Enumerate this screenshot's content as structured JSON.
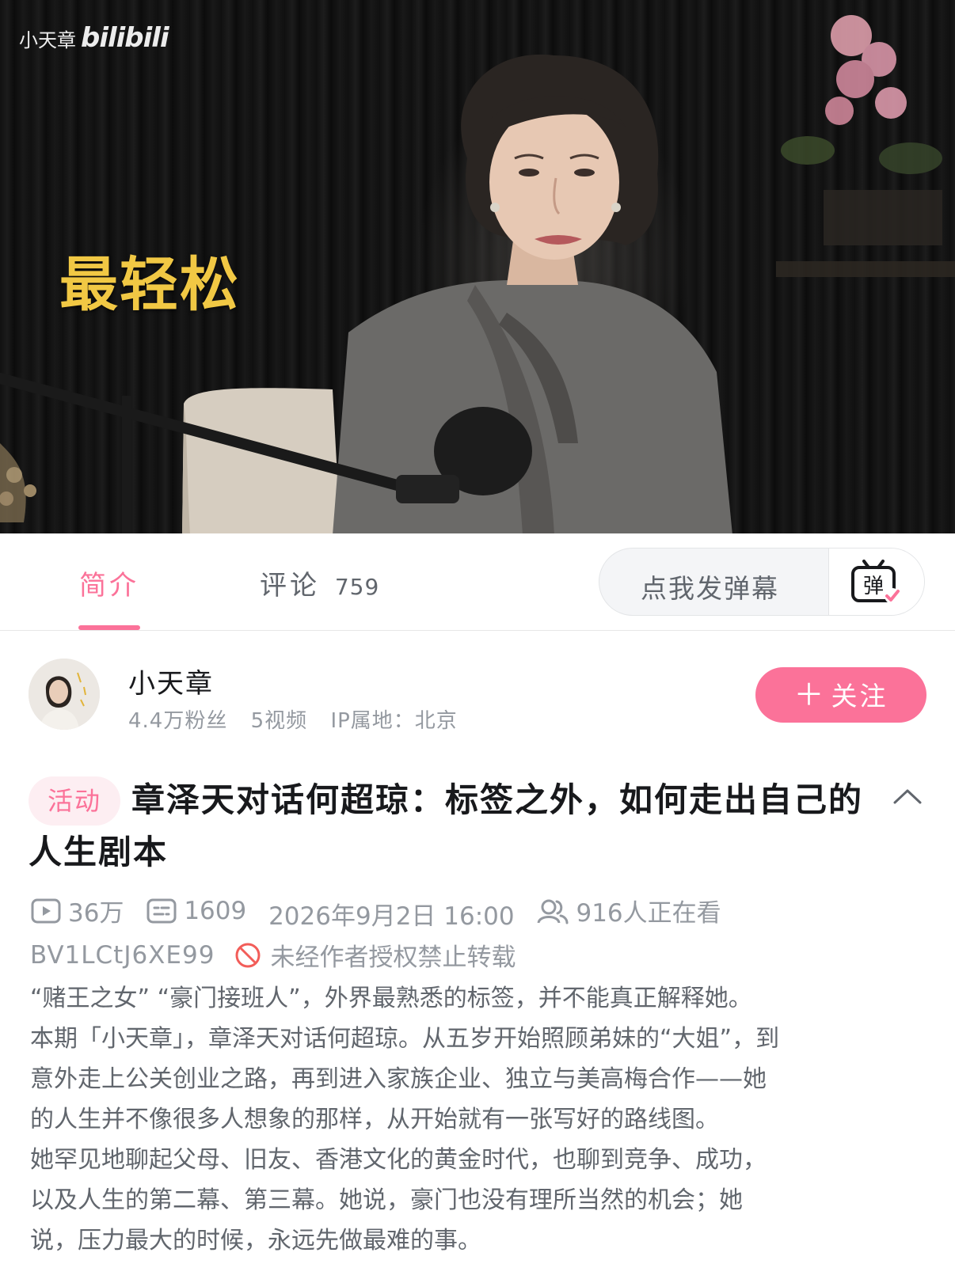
{
  "video": {
    "watermark": "小天章",
    "brand": "bilibili",
    "subtitle": "最轻松"
  },
  "tabs": {
    "intro": "简介",
    "comments": "评论",
    "comments_count": "759"
  },
  "danmaku": {
    "placeholder": "点我发弹幕",
    "toggle_icon": "danmaku-toggle-icon",
    "toggle_glyph": "弹"
  },
  "uploader": {
    "name": "小天章",
    "fans": "4.4万粉丝",
    "videos": "5视频",
    "ip": "IP属地：北京",
    "follow_label": "关注"
  },
  "video_info": {
    "badge": "活动",
    "title": "章泽天对话何超琼：标签之外，如何走出自己的人生剧本",
    "views": "36万",
    "danmaku_count": "1609",
    "publish_time": "2026年9月2日 16:00",
    "watching": "916人正在看",
    "bvid": "BV1LCtJ6XE99",
    "copyright": "未经作者授权禁止转载"
  },
  "description": [
    "“赌王之女” “豪门接班人”，外界最熟悉的标签，并不能真正解释她。",
    "本期「小天章」，章泽天对话何超琼。从五岁开始照顾弟妹的“大姐”，到",
    "意外走上公关创业之路，再到进入家族企业、独立与美高梅合作——她",
    "的人生并不像很多人想象的那样，从开始就有一张写好的路线图。",
    "她罕见地聊起父母、旧友、香港文化的黄金时代，也聊到竞争、成功，",
    "以及人生的第二幕、第三幕。她说，豪门也没有理所当然的机会；她",
    "说，压力最大的时候，永远先做最难的事。"
  ],
  "colors": {
    "accent": "#fb7299",
    "text_primary": "#18191c",
    "text_secondary": "#61666d",
    "text_muted": "#9499a0",
    "caption_yellow": "#f1c844"
  }
}
